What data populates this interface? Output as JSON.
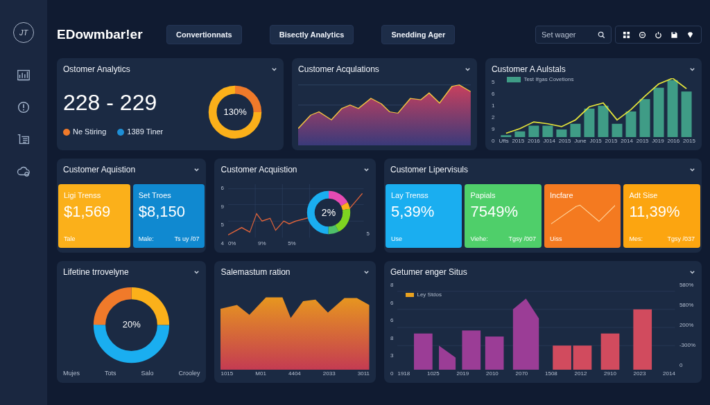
{
  "sidebar": {
    "logo": "JT"
  },
  "header": {
    "brand": "EDowmbar!er",
    "tabs": [
      {
        "label": "Convertionnats",
        "selected": false
      },
      {
        "label": "Bisectly Analytics",
        "selected": false
      },
      {
        "label": "Snedding Ager",
        "selected": false
      }
    ],
    "search": {
      "placeholder": "Set wager"
    }
  },
  "row_1": {
    "analytics": {
      "title": "Ostomer Analytics",
      "value": "228 - 229",
      "legend": [
        {
          "label": "Ne Stiring",
          "color": "#f07a2a"
        },
        {
          "label": "1389 Tiner",
          "color": "#1e8fd6"
        }
      ],
      "donut_label": "130%"
    },
    "acquisitions": {
      "title": "Customer Acqulations"
    },
    "bars": {
      "title": "Customer A Aulstals",
      "legend": "Test Ifgas Covetions",
      "y_labels": [
        "5",
        "6",
        "1",
        "2",
        "9",
        "0"
      ],
      "x_labels": [
        "Ufts",
        "2015",
        "2016",
        "J014",
        "2015",
        "June",
        "J015",
        "2015",
        "2014",
        "2015",
        "J019",
        "2016",
        "2015"
      ]
    }
  },
  "row_2": {
    "acquisition_tiles": {
      "title": "Customer Aquistion",
      "tiles": [
        {
          "kind": "value",
          "label": "Ligi Trenss",
          "value": "$1,569",
          "foot": "Tale",
          "color": "#fbb01a"
        },
        {
          "kind": "value",
          "label": "Set Troes",
          "value": "$8,150",
          "foot": "Male:",
          "foot_right": "Ts uy /07",
          "color": "#1089d0"
        }
      ]
    },
    "acquisition_chart": {
      "title": "Customer Acquistion",
      "y_labels": [
        "6",
        "9",
        "5",
        "4"
      ],
      "x_labels": [
        "0%",
        "9%",
        "5%"
      ],
      "right_label": "5",
      "donut_label": "2%"
    },
    "supervisuals": {
      "title": "Customer Lipervisuls",
      "tiles": [
        {
          "kind": "value",
          "label": "Lay Trenss",
          "value": "5,39%",
          "foot": "Use",
          "color": "#1aaef0"
        },
        {
          "kind": "value",
          "label": "Papials",
          "value": "7549%",
          "foot": "Viehe:",
          "foot_right": "Tgsy /007",
          "color": "#4fcf6a"
        },
        {
          "kind": "sparkline",
          "label": "Incfare",
          "foot": "Uiss",
          "color": "#f47a20"
        },
        {
          "kind": "value",
          "label": "Adt Sise",
          "value": "11,39%",
          "foot": "Mes:",
          "foot_right": "Tgsy /037",
          "color": "#fca510"
        }
      ]
    }
  },
  "row_3": {
    "lifetime": {
      "title": "Lifetine trrovelyne",
      "donut_label": "20%",
      "labels": [
        "Mujes",
        "Tots",
        "Salo",
        "Crooley"
      ]
    },
    "sales": {
      "title": "Salemastum ration",
      "x_labels": [
        "1015",
        "M01",
        "4404",
        "2033",
        "3011"
      ]
    },
    "status": {
      "title": "Getumer enger Situs",
      "legend": "Ley Stdos",
      "y_labels": [
        "8",
        "6",
        "6",
        "8",
        "3",
        "0"
      ],
      "y_right_labels": [
        "580%",
        "580%",
        "200%",
        "-300%",
        "0"
      ],
      "x_labels": [
        "1918",
        "1025",
        "2019",
        "2010",
        "2070",
        "1508",
        "2012",
        "2910",
        "2023",
        "2014"
      ]
    }
  }
}
